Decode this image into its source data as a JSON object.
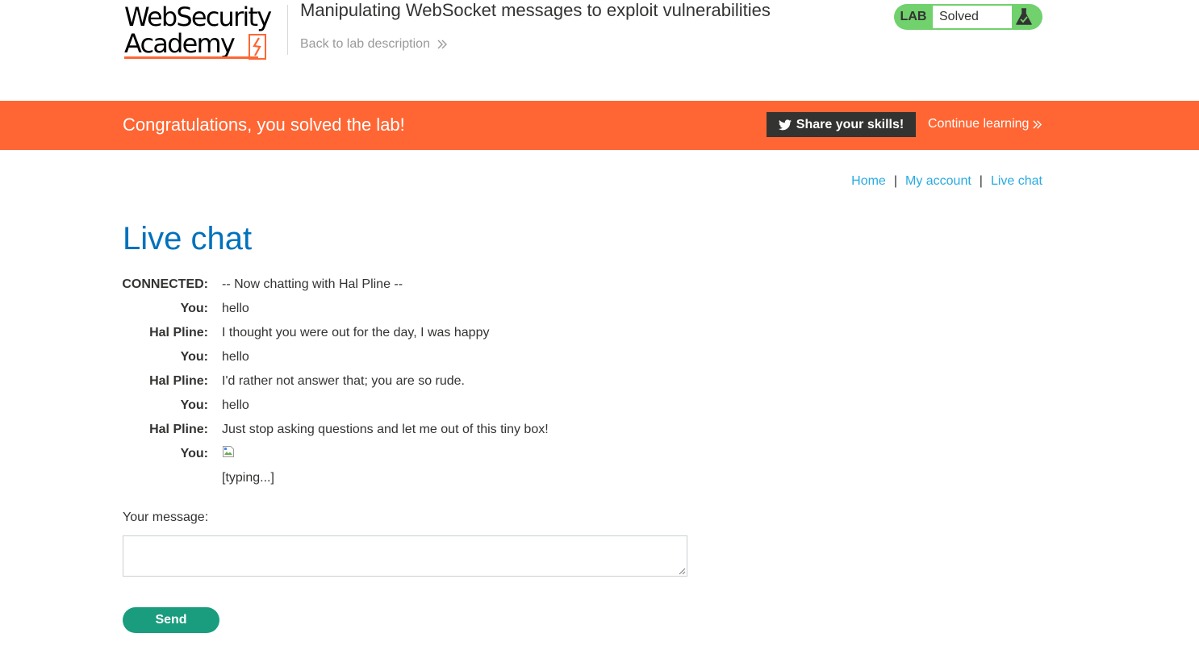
{
  "header": {
    "logo_line1": "WebSecurity",
    "logo_line2": "Academy",
    "lab_title": "Manipulating WebSocket messages to exploit vulnerabilities",
    "back_link": "Back to lab description",
    "status_label": "LAB",
    "status_value": "Solved"
  },
  "banner": {
    "message": "Congratulations, you solved the lab!",
    "share_label": "Share your skills!",
    "continue_label": "Continue learning"
  },
  "nav": {
    "home": "Home",
    "separator": "|",
    "my_account": "My account",
    "live_chat": "Live chat"
  },
  "page": {
    "title": "Live chat"
  },
  "chat": {
    "messages": [
      {
        "who": "CONNECTED:",
        "text": "-- Now chatting with Hal Pline --"
      },
      {
        "who": "You:",
        "text": "hello"
      },
      {
        "who": "Hal Pline:",
        "text": "I thought you were out for the day, I was happy"
      },
      {
        "who": "You:",
        "text": "hello"
      },
      {
        "who": "Hal Pline:",
        "text": "I'd rather not answer that; you are so rude."
      },
      {
        "who": "You:",
        "text": "hello"
      },
      {
        "who": "Hal Pline:",
        "text": "Just stop asking questions and let me out of this tiny box!"
      },
      {
        "who": "You:",
        "text": ""
      },
      {
        "who": "",
        "text": "[typing...]"
      }
    ]
  },
  "form": {
    "label": "Your message:",
    "value": "",
    "send_label": "Send"
  },
  "colors": {
    "accent": "#ff6633",
    "link": "#29abe2",
    "title": "#0071bc",
    "solved": "#70d16d",
    "send": "#1a9c7e"
  }
}
